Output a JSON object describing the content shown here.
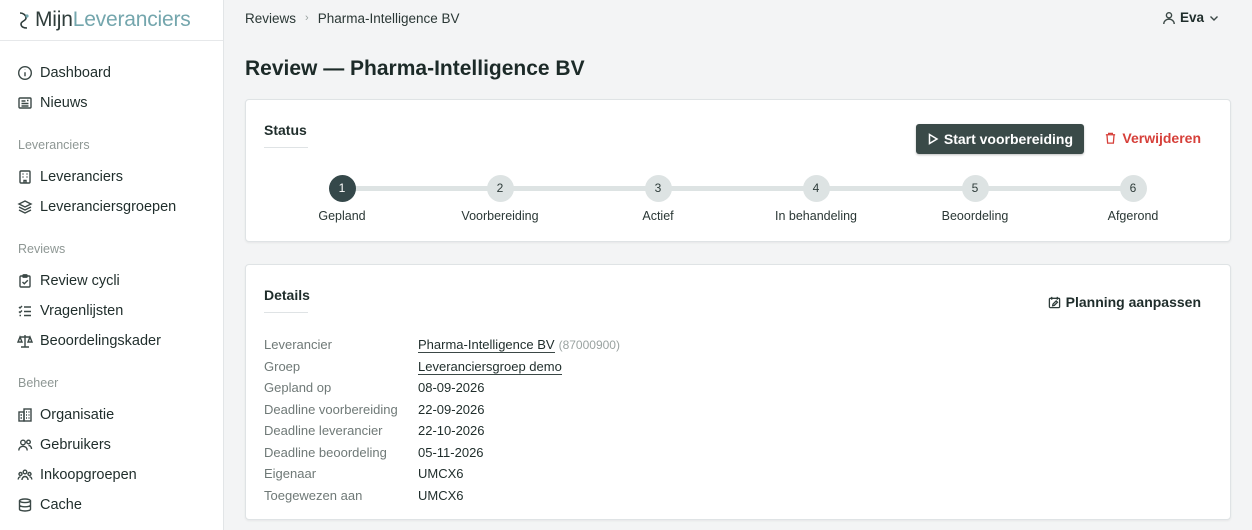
{
  "app": {
    "brand_part1": "Mijn",
    "brand_part2": "Leveranciers"
  },
  "sidebar": {
    "top_items": [
      {
        "label": "Dashboard",
        "icon": "info-circle-icon"
      },
      {
        "label": "Nieuws",
        "icon": "newspaper-icon"
      }
    ],
    "sections": [
      {
        "title": "Leveranciers",
        "items": [
          {
            "label": "Leveranciers",
            "icon": "building-icon"
          },
          {
            "label": "Leveranciersgroepen",
            "icon": "layers-icon"
          }
        ]
      },
      {
        "title": "Reviews",
        "items": [
          {
            "label": "Review cycli",
            "icon": "clipboard-check-icon"
          },
          {
            "label": "Vragenlijsten",
            "icon": "checklist-icon"
          },
          {
            "label": "Beoordelingskader",
            "icon": "scale-icon"
          }
        ]
      },
      {
        "title": "Beheer",
        "items": [
          {
            "label": "Organisatie",
            "icon": "office-icon"
          },
          {
            "label": "Gebruikers",
            "icon": "users-icon"
          },
          {
            "label": "Inkoopgroepen",
            "icon": "group-icon"
          },
          {
            "label": "Cache",
            "icon": "database-icon"
          }
        ]
      }
    ]
  },
  "breadcrumb": {
    "parent": "Reviews",
    "current": "Pharma-Intelligence BV"
  },
  "user": {
    "name": "Eva"
  },
  "page": {
    "title": "Review — Pharma-Intelligence BV"
  },
  "status": {
    "title": "Status",
    "start_button": "Start voorbereiding",
    "delete_button": "Verwijderen",
    "active_step": 1,
    "steps": [
      {
        "num": "1",
        "label": "Gepland"
      },
      {
        "num": "2",
        "label": "Voorbereiding"
      },
      {
        "num": "3",
        "label": "Actief"
      },
      {
        "num": "4",
        "label": "In behandeling"
      },
      {
        "num": "5",
        "label": "Beoordeling"
      },
      {
        "num": "6",
        "label": "Afgerond"
      }
    ]
  },
  "details": {
    "title": "Details",
    "plan_button": "Planning aanpassen",
    "rows": [
      {
        "key": "Leverancier",
        "value": "Pharma-Intelligence BV",
        "link": true,
        "extra": "(87000900)"
      },
      {
        "key": "Groep",
        "value": "Leveranciersgroep demo",
        "link": true
      },
      {
        "key": "Gepland op",
        "value": "08-09-2026"
      },
      {
        "key": "Deadline voorbereiding",
        "value": "22-09-2026"
      },
      {
        "key": "Deadline leverancier",
        "value": "22-10-2026"
      },
      {
        "key": "Deadline beoordeling",
        "value": "05-11-2026"
      },
      {
        "key": "Eigenaar",
        "value": "UMCX6"
      },
      {
        "key": "Toegewezen aan",
        "value": "UMCX6"
      }
    ]
  }
}
